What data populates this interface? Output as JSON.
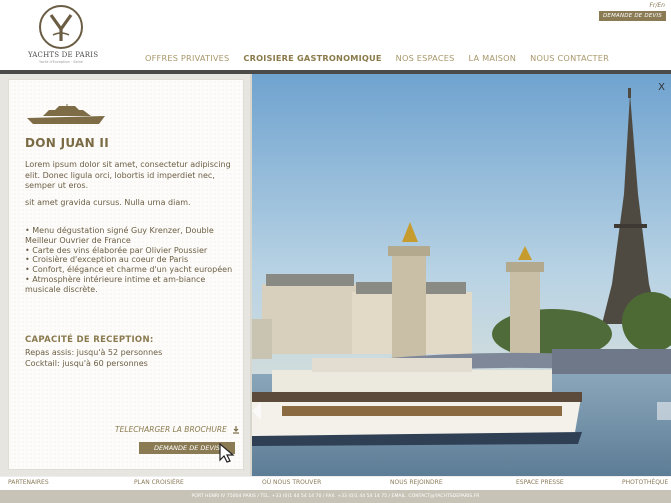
{
  "header": {
    "logo_name": "YACHTS DE PARIS",
    "logo_tagline": "Yacht d'Exception · Seine",
    "lang": "Fr/En",
    "cta": "DEMANDE DE DEVIS",
    "nav": [
      "OFFRES PRIVATIVES",
      "CROISIERE GASTRONOMIQUE",
      "NOS ESPACES",
      "LA MAISON",
      "NOUS CONTACTER"
    ],
    "active_nav": "CROISIERE GASTRONOMIQUE"
  },
  "panel": {
    "title": "DON JUAN II",
    "lorem": "Lorem ipsum dolor sit amet, consectetur adipiscing elit. Donec ligula orci, lobortis id imperdiet nec, semper ut eros.",
    "lorem2": "sit amet gravida cursus. Nulla urna diam.",
    "bullets": [
      "• Menu dégustation signé Guy Krenzer, Double Meilleur Ouvrier de France",
      "• Carte des vins élaborée par Olivier Poussier",
      "• Croisière d'exception au coeur de Paris",
      "• Confort, élégance et charme d'un yacht européen",
      "• Atmosphère intérieure intime et am-biance musicale discrète."
    ],
    "capacity_title": "CAPACITÉ DE RECEPTION:",
    "capacity_seated": "Repas assis: jusqu'à 52 personnes",
    "capacity_cocktail": "Cocktail: jusqu'à 60 personnes",
    "brochure": "TELECHARGER LA BROCHURE",
    "cta": "DEMANDE DE DEVIS"
  },
  "photo": {
    "close": "X"
  },
  "footer": {
    "links": [
      "PARTENAIRES",
      "PLAN CROISIÈRE",
      "OÙ NOUS TROUVER",
      "NOUS REJOINDRE",
      "ESPACE PRESSE",
      "PHOTOTHÈQUE"
    ],
    "address": "PORT HENRI IV 75004 PARIS  /  TEL. +33 (0)1 44 54 14 70  /  FAX. +33 (0)1 44 54 14 75  /  EMAIL. CONTACT@YACHTSDEPARIS.FR"
  },
  "colors": {
    "accent": "#8b7b55",
    "header_bar": "#4a4a48",
    "footer_bar": "#c7c3b6"
  }
}
